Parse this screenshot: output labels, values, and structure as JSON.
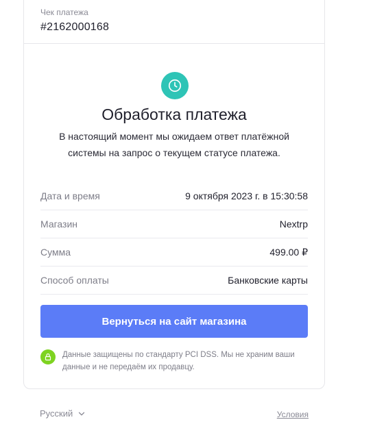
{
  "receipt": {
    "label": "Чек платежа",
    "number": "#2162000168"
  },
  "status": {
    "icon": "clock-icon",
    "title": "Обработка платежа",
    "description": "В настоящий момент мы ожидаем ответ платёжной системы на запрос о текущем статусе платежа.",
    "icon_color": "#2ec4b6"
  },
  "details": [
    {
      "label": "Дата и время",
      "value": "9 октября 2023 г. в 15:30:58"
    },
    {
      "label": "Магазин",
      "value": "Nextrp"
    },
    {
      "label": "Сумма",
      "value": "499.00 ₽"
    },
    {
      "label": "Способ оплаты",
      "value": "Банковские карты"
    }
  ],
  "back_button": {
    "label": "Вернуться на сайт магазина",
    "color": "#5b7cf7"
  },
  "security": {
    "icon": "lock-icon",
    "text": "Данные защищены по стандарту PCI DSS. Мы не храним ваши данные и не передаём их продавцу.",
    "icon_color": "#7ed321"
  },
  "footer": {
    "language": "Русский",
    "terms": "Условия"
  }
}
